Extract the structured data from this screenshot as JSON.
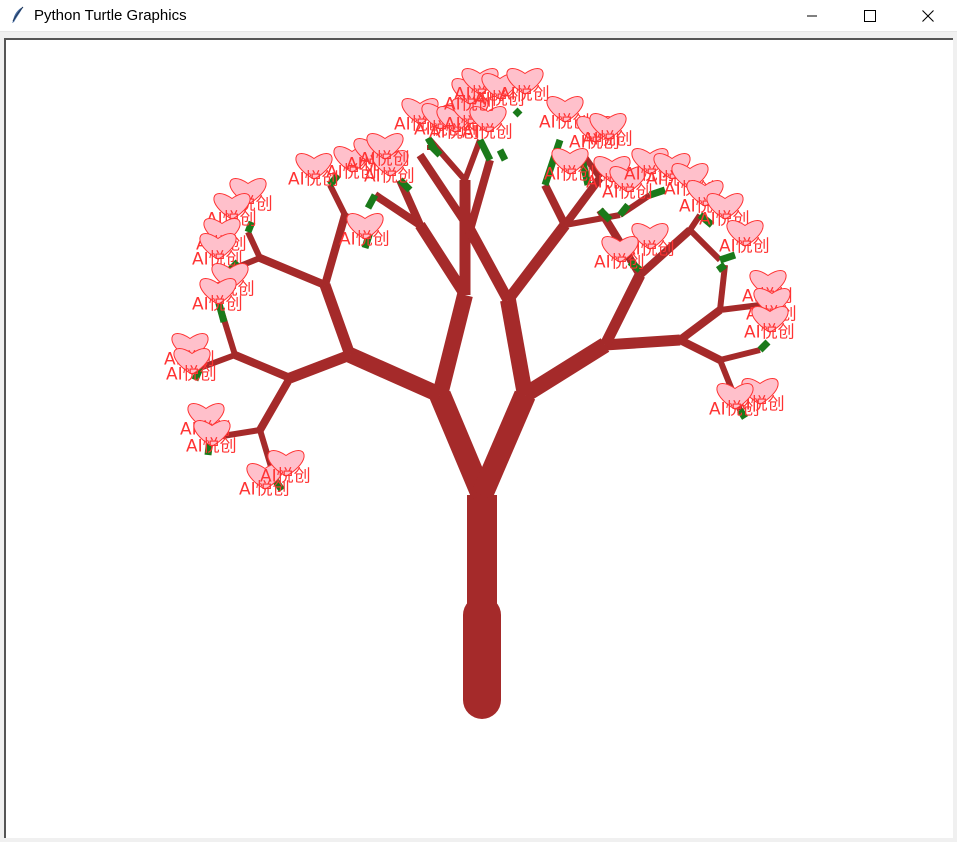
{
  "window": {
    "title": "Python Turtle Graphics",
    "app_icon": "feather-icon",
    "controls": [
      "minimize-icon",
      "maximize-icon",
      "close-icon"
    ]
  },
  "canvas": {
    "background": "#ffffff",
    "trunk_color": "#a52a2a",
    "leaf_color": "#1a7a1a",
    "blossom_fill": "#ffc0cb",
    "blossom_stroke": "#ff3333",
    "blossom_label": "AI悦创"
  }
}
